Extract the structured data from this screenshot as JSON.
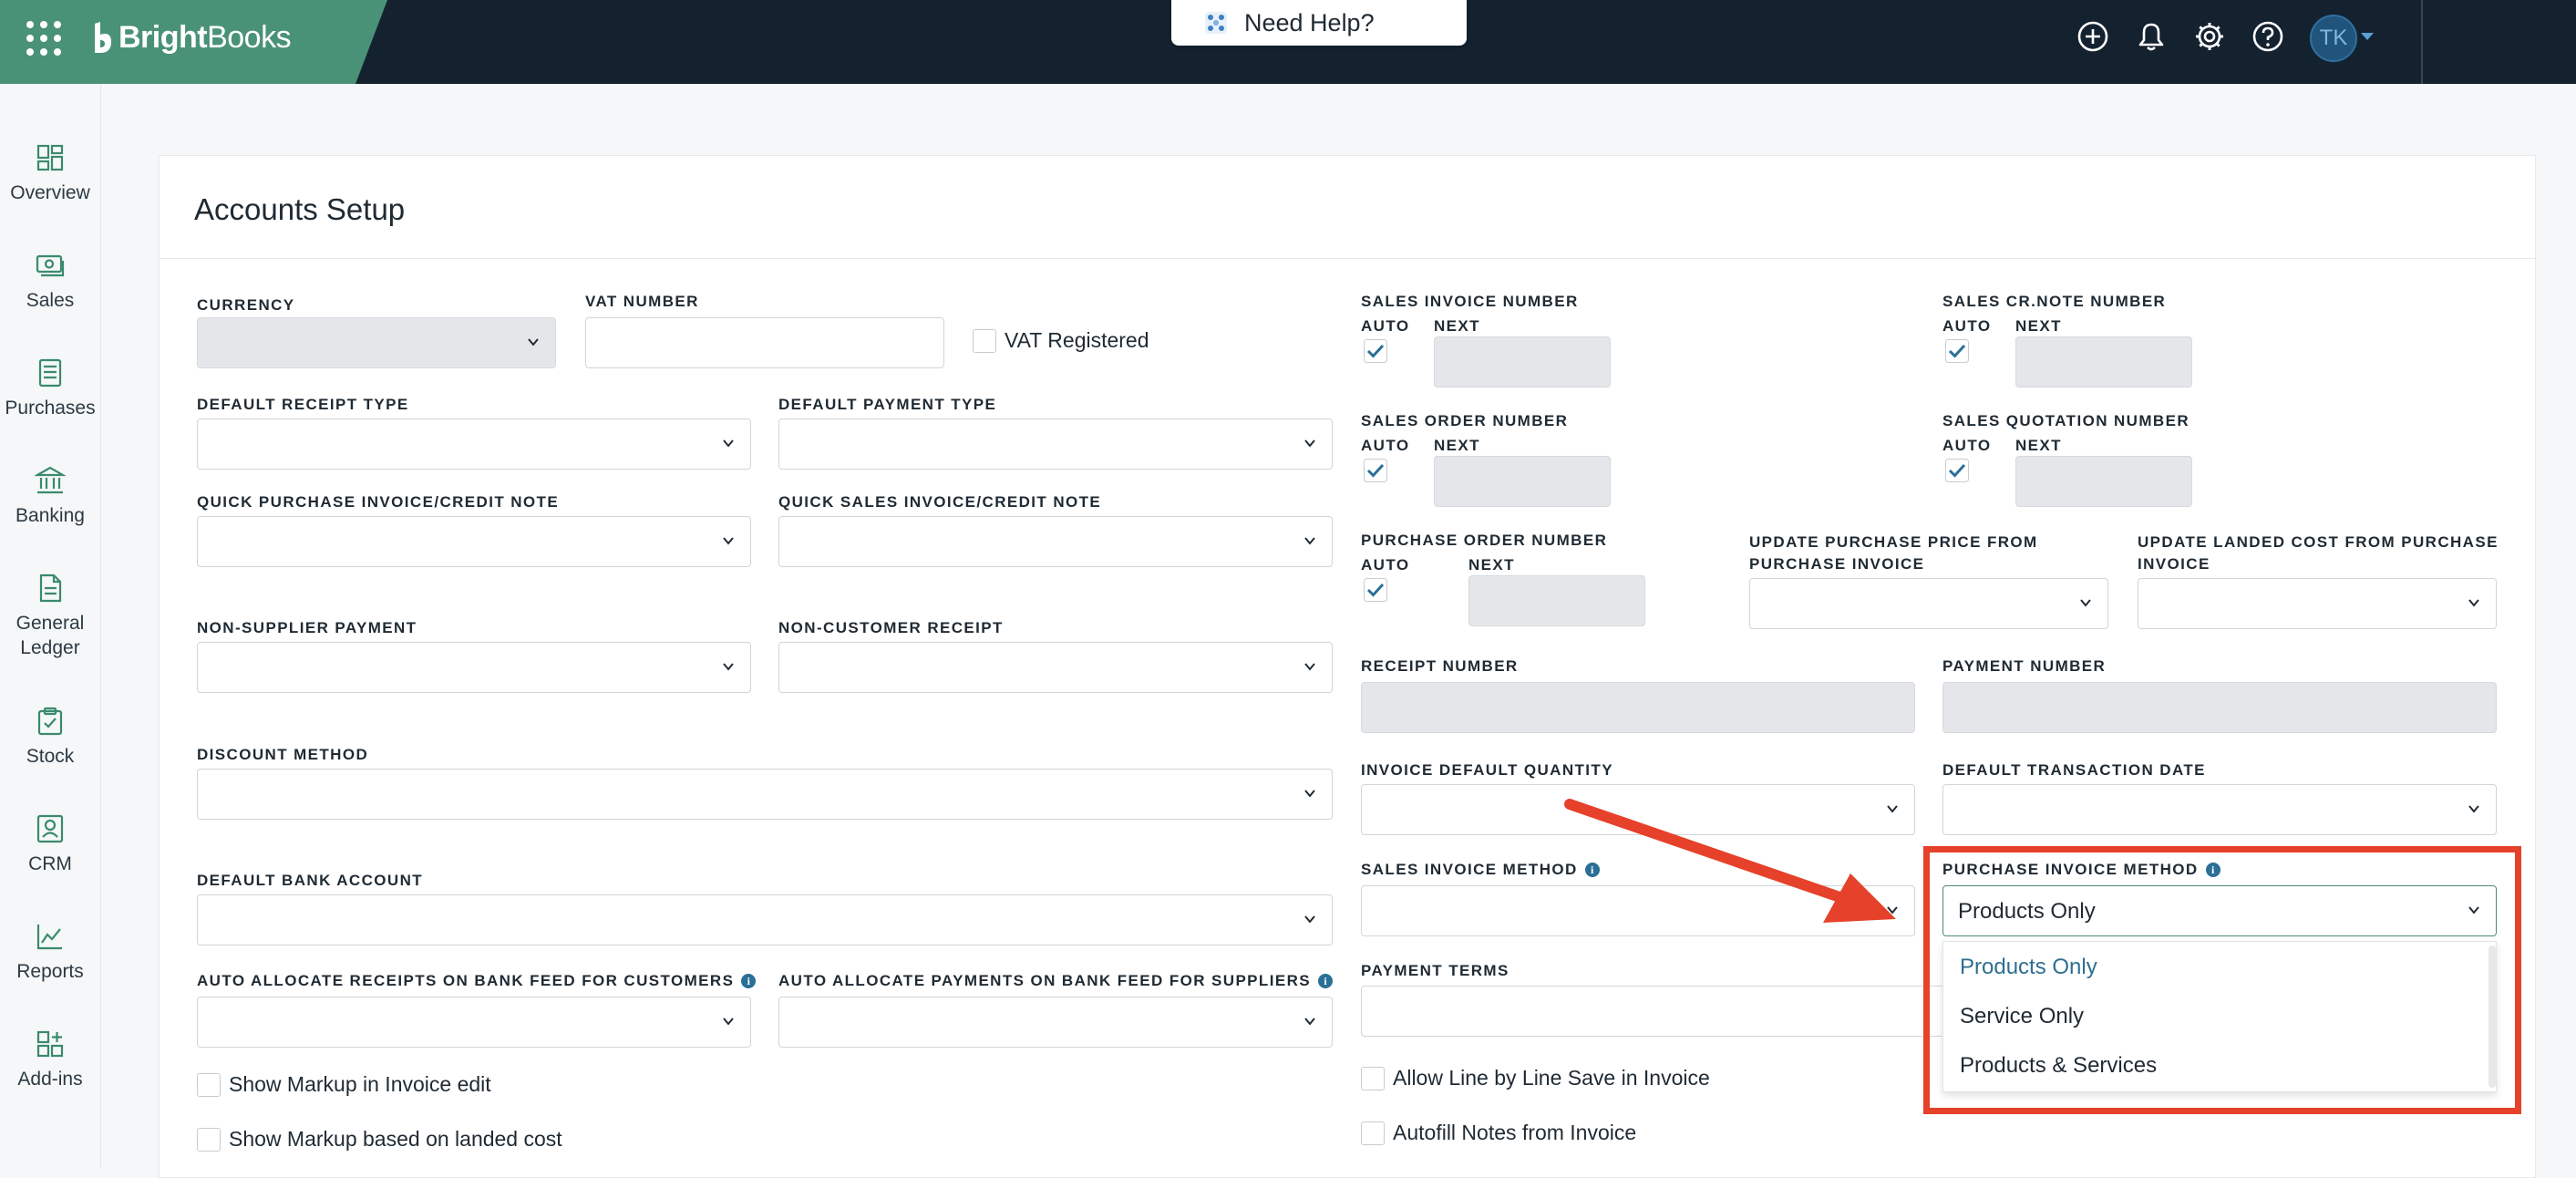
{
  "brand": {
    "name_bold": "Bright",
    "name_light": "Books"
  },
  "help": {
    "label": "Need Help?"
  },
  "user": {
    "initials": "TK"
  },
  "sidebar": {
    "items": [
      {
        "label": "Overview"
      },
      {
        "label": "Sales"
      },
      {
        "label": "Purchases"
      },
      {
        "label": "Banking"
      },
      {
        "label": "General Ledger"
      },
      {
        "label": "Stock"
      },
      {
        "label": "CRM"
      },
      {
        "label": "Reports"
      },
      {
        "label": "Add-ins"
      }
    ]
  },
  "page": {
    "title": "Accounts Setup"
  },
  "form": {
    "currency": "CURRENCY",
    "vat_number": "VAT NUMBER",
    "vat_registered": "VAT Registered",
    "default_receipt_type": "DEFAULT RECEIPT TYPE",
    "default_payment_type": "DEFAULT PAYMENT TYPE",
    "quick_purchase": "QUICK PURCHASE INVOICE/CREDIT NOTE",
    "quick_sales": "QUICK SALES INVOICE/CREDIT NOTE",
    "non_supplier_payment": "NON-SUPPLIER PAYMENT",
    "non_customer_receipt": "NON-CUSTOMER RECEIPT",
    "discount_method": "DISCOUNT METHOD",
    "default_bank_account": "DEFAULT BANK ACCOUNT",
    "auto_alloc_customers": "AUTO ALLOCATE RECEIPTS ON BANK FEED FOR CUSTOMERS",
    "auto_alloc_suppliers": "AUTO ALLOCATE PAYMENTS ON BANK FEED FOR SUPPLIERS",
    "show_markup_edit": "Show Markup in Invoice edit",
    "show_markup_landed": "Show Markup based on landed cost",
    "sales_invoice_number": "SALES INVOICE NUMBER",
    "sales_crnote_number": "SALES CR.NOTE NUMBER",
    "sales_order_number": "SALES ORDER NUMBER",
    "sales_quotation_number": "SALES QUOTATION NUMBER",
    "purchase_order_number": "PURCHASE ORDER NUMBER",
    "update_purchase_price": "UPDATE PURCHASE PRICE FROM PURCHASE INVOICE",
    "update_landed_cost": "UPDATE LANDED COST FROM PURCHASE INVOICE",
    "auto": "AUTO",
    "next": "NEXT",
    "receipt_number": "RECEIPT NUMBER",
    "payment_number": "PAYMENT NUMBER",
    "invoice_default_quantity": "INVOICE DEFAULT QUANTITY",
    "default_transaction_date": "DEFAULT TRANSACTION DATE",
    "sales_invoice_method": "SALES INVOICE METHOD",
    "purchase_invoice_method": "PURCHASE INVOICE METHOD",
    "purchase_invoice_method_value": "Products Only",
    "payment_terms": "PAYMENT TERMS",
    "allow_line_save": "Allow Line by Line Save in Invoice",
    "autofill_notes": "Autofill Notes from Invoice",
    "info_glyph": "i"
  },
  "dropdown": {
    "options": [
      "Products Only",
      "Service Only",
      "Products & Services"
    ],
    "selected": "Products Only"
  },
  "colors": {
    "topbar": "#14222f",
    "brand": "#4a9277",
    "highlight": "#e6412a",
    "accent": "#2e6f90"
  }
}
